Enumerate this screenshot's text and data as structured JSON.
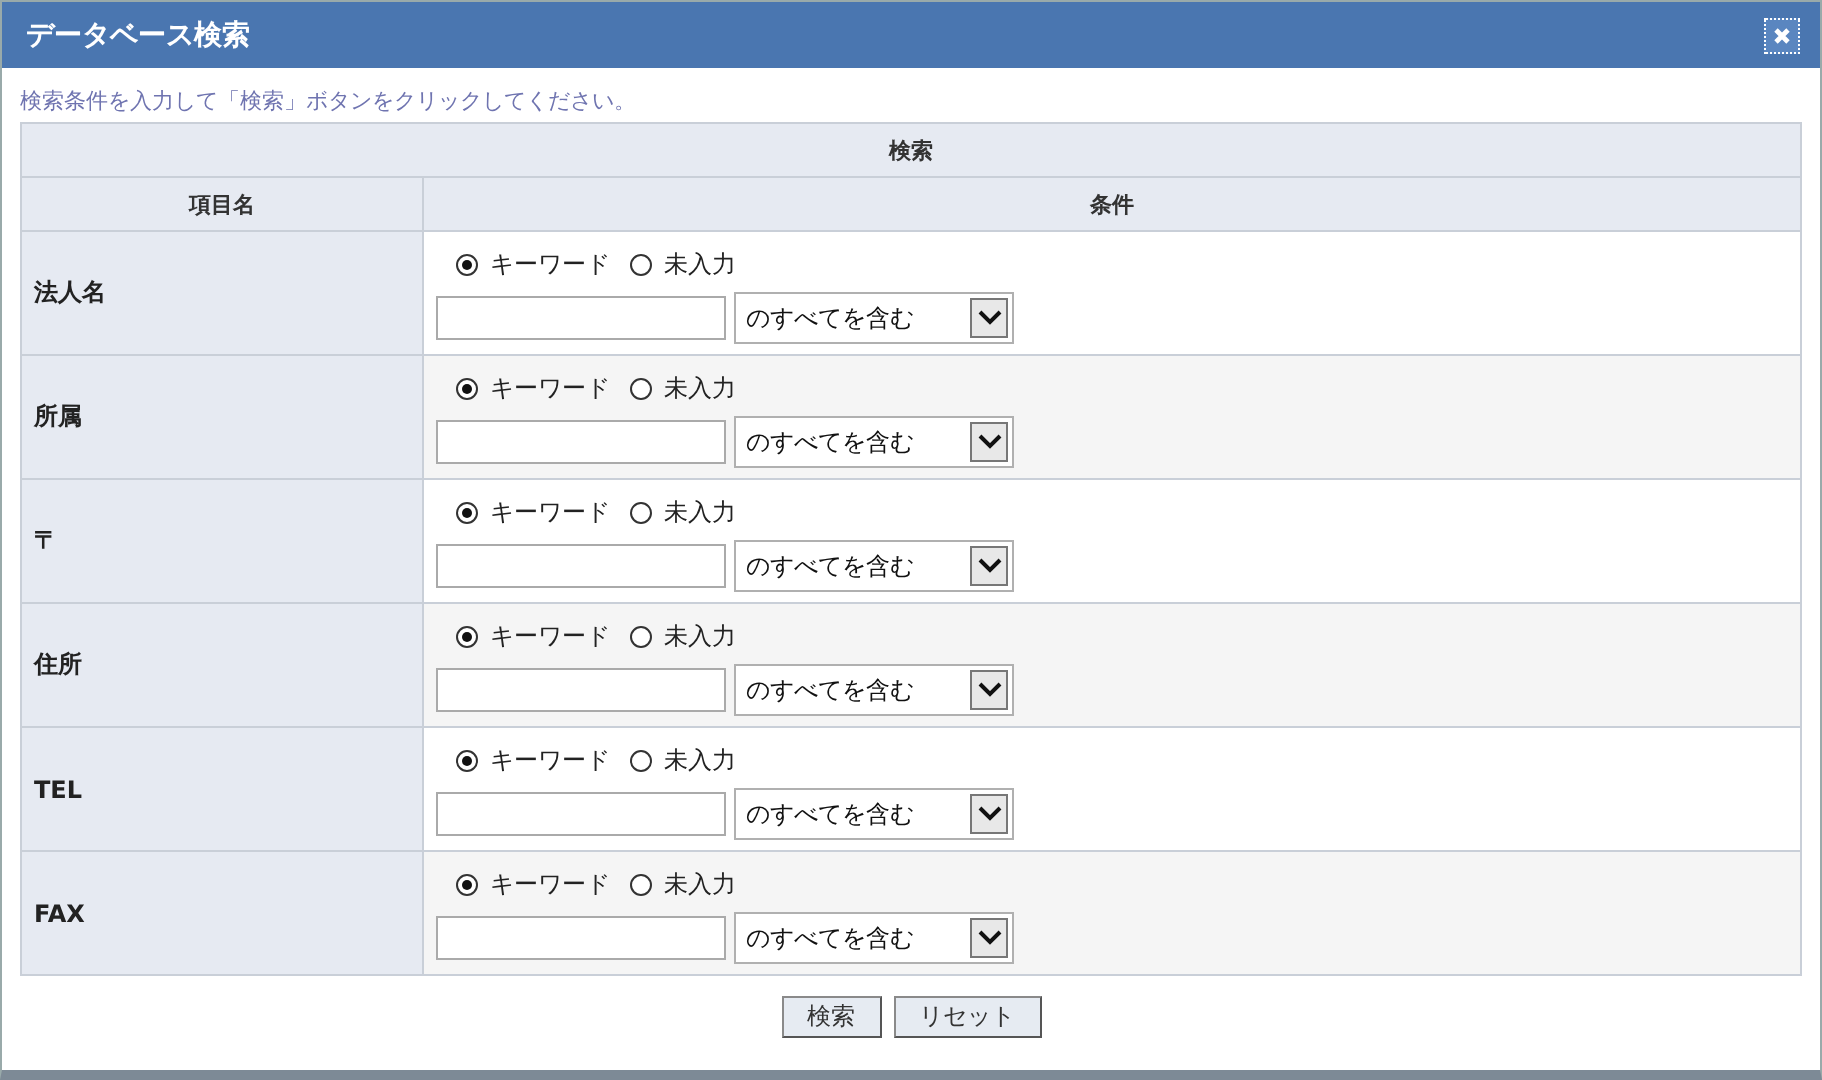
{
  "window": {
    "title": "データベース検索"
  },
  "instruction": "検索条件を入力して「検索」ボタンをクリックしてください。",
  "table": {
    "caption": "検索",
    "columns": [
      "項目名",
      "条件"
    ],
    "rows": [
      {
        "label": "法人名",
        "options": [
          {
            "label": "キーワード",
            "selected": true
          },
          {
            "label": "未入力",
            "selected": false
          }
        ],
        "match": "のすべてを含む"
      },
      {
        "label": "所属",
        "options": [
          {
            "label": "キーワード",
            "selected": true
          },
          {
            "label": "未入力",
            "selected": false
          }
        ],
        "match": "のすべてを含む"
      },
      {
        "label": "〒",
        "options": [
          {
            "label": "キーワード",
            "selected": true
          },
          {
            "label": "未入力",
            "selected": false
          }
        ],
        "match": "のすべてを含む"
      },
      {
        "label": "住所",
        "options": [
          {
            "label": "キーワード",
            "selected": true
          },
          {
            "label": "未入力",
            "selected": false
          }
        ],
        "match": "のすべてを含む"
      },
      {
        "label": "TEL",
        "options": [
          {
            "label": "キーワード",
            "selected": true
          },
          {
            "label": "未入力",
            "selected": false
          }
        ],
        "match": "のすべてを含む"
      },
      {
        "label": "FAX",
        "options": [
          {
            "label": "キーワード",
            "selected": true
          },
          {
            "label": "未入力",
            "selected": false
          }
        ],
        "match": "のすべてを含む"
      }
    ]
  },
  "buttons": [
    "検索",
    "リセット"
  ]
}
